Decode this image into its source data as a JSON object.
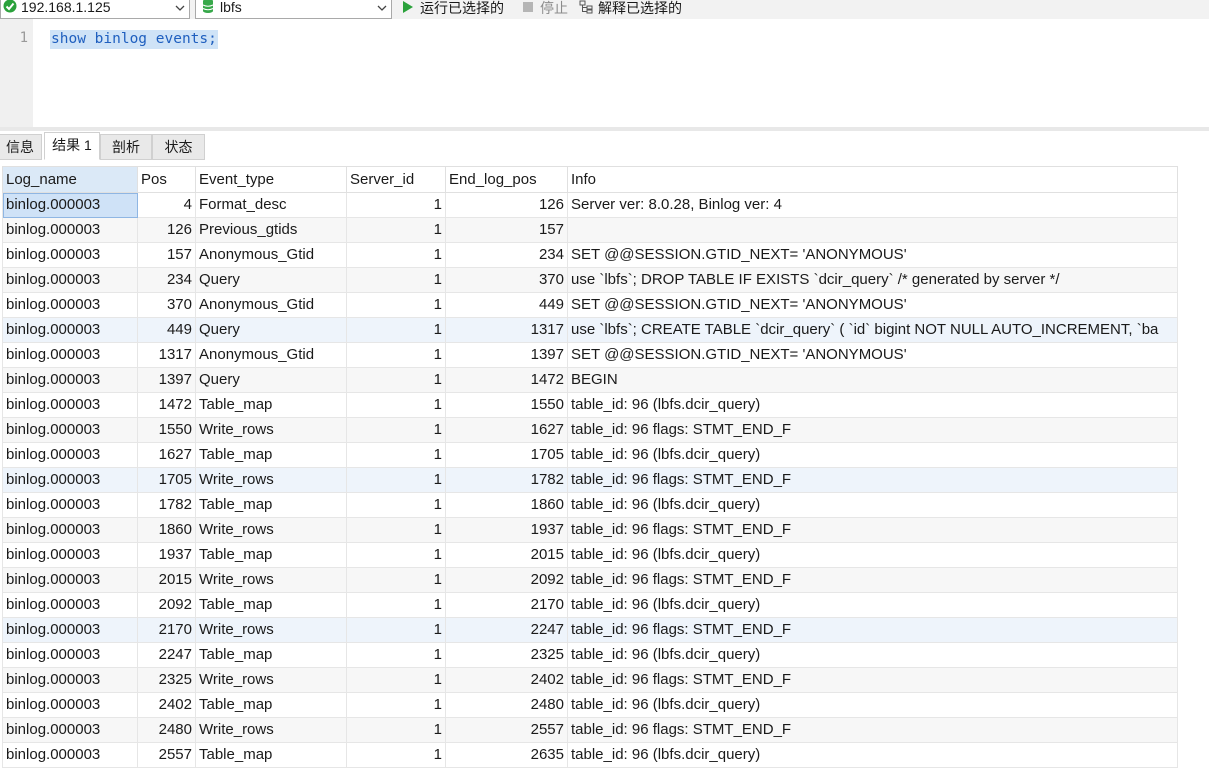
{
  "toolbar": {
    "connection": "192.168.1.125",
    "database": "lbfs",
    "run_selected": "运行已选择的",
    "stop": "停止",
    "explain_selected": "解释已选择的"
  },
  "editor": {
    "line_number": "1",
    "code": "show binlog events;"
  },
  "tabs": [
    {
      "label": "信息"
    },
    {
      "label": "结果 1",
      "active": true
    },
    {
      "label": "剖析"
    },
    {
      "label": "状态"
    }
  ],
  "grid": {
    "columns": [
      "Log_name",
      "Pos",
      "Event_type",
      "Server_id",
      "End_log_pos",
      "Info"
    ],
    "rows": [
      [
        "binlog.000003",
        "4",
        "Format_desc",
        "1",
        "126",
        "Server ver: 8.0.28, Binlog ver: 4"
      ],
      [
        "binlog.000003",
        "126",
        "Previous_gtids",
        "1",
        "157",
        ""
      ],
      [
        "binlog.000003",
        "157",
        "Anonymous_Gtid",
        "1",
        "234",
        "SET @@SESSION.GTID_NEXT= 'ANONYMOUS'"
      ],
      [
        "binlog.000003",
        "234",
        "Query",
        "1",
        "370",
        "use `lbfs`; DROP TABLE IF EXISTS `dcir_query` /* generated by server */"
      ],
      [
        "binlog.000003",
        "370",
        "Anonymous_Gtid",
        "1",
        "449",
        "SET @@SESSION.GTID_NEXT= 'ANONYMOUS'"
      ],
      [
        "binlog.000003",
        "449",
        "Query",
        "1",
        "1317",
        "use `lbfs`; CREATE TABLE `dcir_query`  (  `id` bigint NOT NULL AUTO_INCREMENT,  `ba"
      ],
      [
        "binlog.000003",
        "1317",
        "Anonymous_Gtid",
        "1",
        "1397",
        "SET @@SESSION.GTID_NEXT= 'ANONYMOUS'"
      ],
      [
        "binlog.000003",
        "1397",
        "Query",
        "1",
        "1472",
        "BEGIN"
      ],
      [
        "binlog.000003",
        "1472",
        "Table_map",
        "1",
        "1550",
        "table_id: 96 (lbfs.dcir_query)"
      ],
      [
        "binlog.000003",
        "1550",
        "Write_rows",
        "1",
        "1627",
        "table_id: 96 flags: STMT_END_F"
      ],
      [
        "binlog.000003",
        "1627",
        "Table_map",
        "1",
        "1705",
        "table_id: 96 (lbfs.dcir_query)"
      ],
      [
        "binlog.000003",
        "1705",
        "Write_rows",
        "1",
        "1782",
        "table_id: 96 flags: STMT_END_F"
      ],
      [
        "binlog.000003",
        "1782",
        "Table_map",
        "1",
        "1860",
        "table_id: 96 (lbfs.dcir_query)"
      ],
      [
        "binlog.000003",
        "1860",
        "Write_rows",
        "1",
        "1937",
        "table_id: 96 flags: STMT_END_F"
      ],
      [
        "binlog.000003",
        "1937",
        "Table_map",
        "1",
        "2015",
        "table_id: 96 (lbfs.dcir_query)"
      ],
      [
        "binlog.000003",
        "2015",
        "Write_rows",
        "1",
        "2092",
        "table_id: 96 flags: STMT_END_F"
      ],
      [
        "binlog.000003",
        "2092",
        "Table_map",
        "1",
        "2170",
        "table_id: 96 (lbfs.dcir_query)"
      ],
      [
        "binlog.000003",
        "2170",
        "Write_rows",
        "1",
        "2247",
        "table_id: 96 flags: STMT_END_F"
      ],
      [
        "binlog.000003",
        "2247",
        "Table_map",
        "1",
        "2325",
        "table_id: 96 (lbfs.dcir_query)"
      ],
      [
        "binlog.000003",
        "2325",
        "Write_rows",
        "1",
        "2402",
        "table_id: 96 flags: STMT_END_F"
      ],
      [
        "binlog.000003",
        "2402",
        "Table_map",
        "1",
        "2480",
        "table_id: 96 (lbfs.dcir_query)"
      ],
      [
        "binlog.000003",
        "2480",
        "Write_rows",
        "1",
        "2557",
        "table_id: 96 flags: STMT_END_F"
      ],
      [
        "binlog.000003",
        "2557",
        "Table_map",
        "1",
        "2635",
        "table_id: 96 (lbfs.dcir_query)"
      ]
    ]
  },
  "colors": {
    "accent_green": "#2aa13b",
    "selection_blue": "#cfe2f7",
    "code_blue": "#1f5fbf"
  }
}
